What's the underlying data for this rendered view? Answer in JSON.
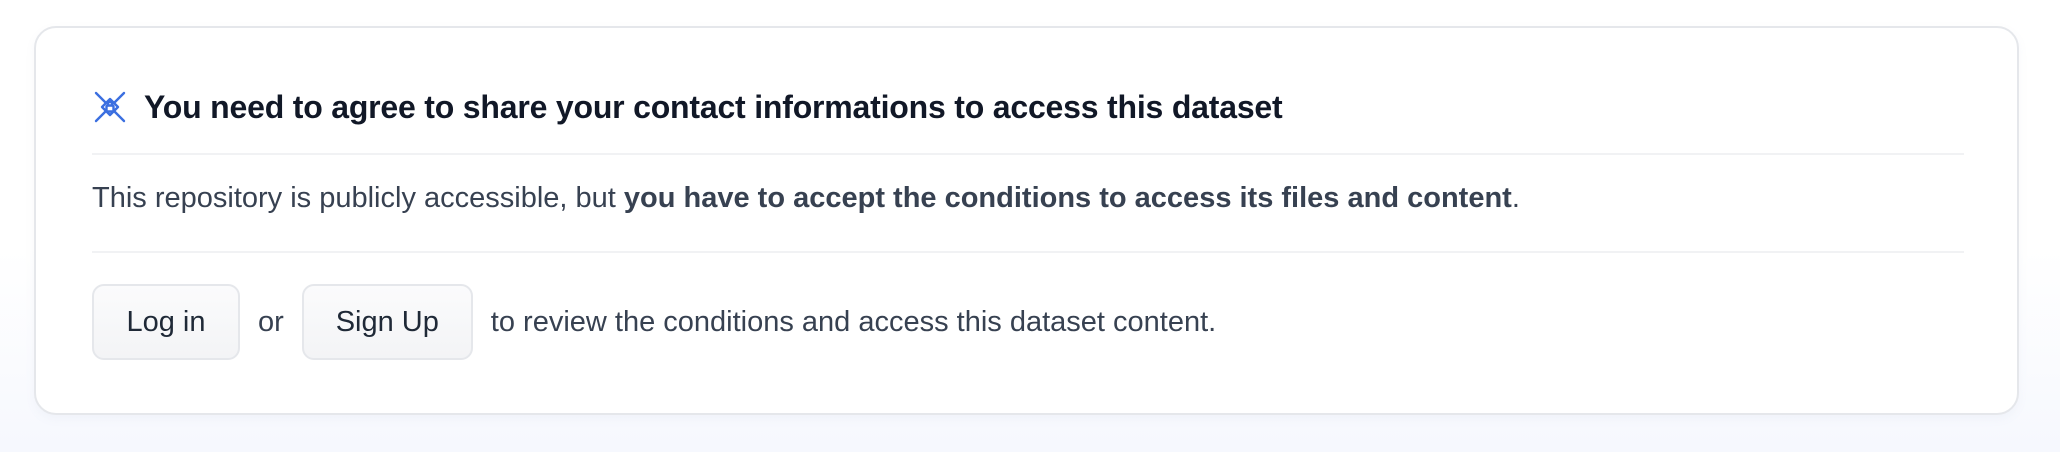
{
  "gate": {
    "icon": "gated-dataset-icon",
    "accent_color": "#3b6fe0",
    "heading": "You need to agree to share your contact informations to access this dataset",
    "notice_prefix": "This repository is publicly accessible, but ",
    "notice_emphasis": "you have to accept the conditions to access its files and content",
    "notice_suffix": ".",
    "login_label": "Log in",
    "or_text": "or",
    "signup_label": "Sign Up",
    "tail_text": "to review the conditions and access this dataset content."
  }
}
